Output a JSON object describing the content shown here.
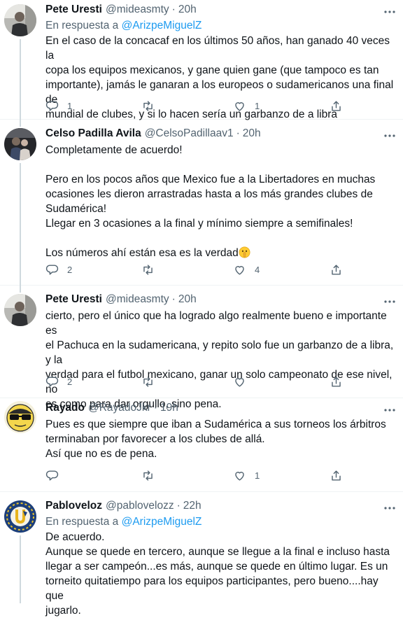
{
  "colors": {
    "accent": "#1d9bf0",
    "secondary_text": "#536471",
    "primary_text": "#0f1419",
    "divider": "#eff3f4"
  },
  "tweets": [
    {
      "name": "Pete Uresti",
      "handle": "@mideasmty",
      "dot": "·",
      "time": "20h",
      "reply_prefix": "En respuesta a",
      "reply_mention": "@ArizpeMiguelZ",
      "lines": [
        "En el caso de la concacaf en los últimos 50 años, han ganado 40 veces la",
        "copa los equipos mexicanos, y gane quien gane (que tampoco es tan",
        "importante), jamás le ganaran a los europeos o sudamericanos una final de",
        "mundial de clubes, y si lo hacen sería un garbanzo de a libra"
      ],
      "replies": "1",
      "retweets": "",
      "likes": "1"
    },
    {
      "name": "Celso Padilla Avila",
      "handle": "@CelsoPadillaav1",
      "dot": "·",
      "time": "20h",
      "lines": [
        "Completamente de acuerdo!",
        "",
        "Pero en los pocos años que Mexico fue a la Libertadores en muchas",
        "ocasiones les dieron arrastradas hasta a los más grandes clubes de",
        "Sudamérica!",
        "Llegar en 3 ocasiones a la final y mínimo siempre a semifinales!",
        "",
        "Los números ahí están esa es la verdad"
      ],
      "emoji": "shushing-face-emoji",
      "replies": "2",
      "retweets": "",
      "likes": "4"
    },
    {
      "name": "Pete Uresti",
      "handle": "@mideasmty",
      "dot": "·",
      "time": "20h",
      "lines": [
        "cierto, pero el único que ha logrado algo realmente bueno e importante es",
        "el Pachuca en la sudamericana, y repito solo fue un garbanzo de a libra, y la",
        "verdad para el futbol mexicano, ganar un solo campeonato de ese nivel, no",
        "es como para dar orgullo, sino pena."
      ],
      "replies": "2",
      "retweets": "",
      "likes": ""
    },
    {
      "name": "Rayado",
      "handle": "@RayadoJkr",
      "dot": "·",
      "time": "19h",
      "lines": [
        "Pues es que siempre que iban a Sudamérica a sus torneos los árbitros",
        "terminaban por favorecer a los clubes de allá.",
        "Así que no es de pena."
      ],
      "replies": "",
      "retweets": "",
      "likes": "1"
    },
    {
      "name": "Pabloveloz",
      "handle": "@pablovelozz",
      "dot": "·",
      "time": "22h",
      "reply_prefix": "En respuesta a",
      "reply_mention": "@ArizpeMiguelZ",
      "lines": [
        "De acuerdo.",
        "Aunque se quede en tercero, aunque se llegue a la final e incluso hasta",
        "llegar a ser campeón...es más, aunque se quede en último lugar. Es un",
        "torneito quitatiempo para los equipos participantes, pero bueno....hay que",
        "jugarlo."
      ]
    }
  ]
}
